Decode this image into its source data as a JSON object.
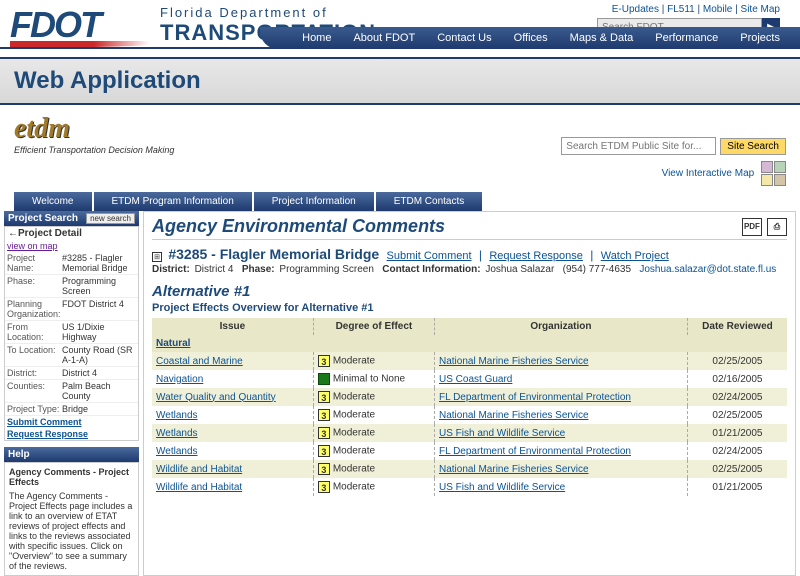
{
  "fdot": {
    "logo_text": "FDOT",
    "dept1": "Florida Department of",
    "dept2": "TRANSPORTATION",
    "util_links": [
      "E-Updates",
      "FL511",
      "Mobile",
      "Site Map"
    ],
    "search_placeholder": "Search FDOT...",
    "nav": [
      "Home",
      "About FDOT",
      "Contact Us",
      "Offices",
      "Maps & Data",
      "Performance",
      "Projects"
    ]
  },
  "app": {
    "banner_title": "Web Application",
    "etdm_logo": "etdm",
    "etdm_sub": "Efficient Transportation Decision Making",
    "etdm_search_placeholder": "Search ETDM Public Site for...",
    "site_search_btn": "Site Search",
    "view_map": "View Interactive Map"
  },
  "tabs": [
    "Welcome",
    "ETDM Program Information",
    "Project Information",
    "ETDM Contacts"
  ],
  "sidebar": {
    "search_head": "Project Search",
    "new_search": "new search",
    "detail_head": "←Project Detail",
    "view_on_map": "view on map",
    "rows": [
      {
        "label": "Project Name:",
        "val": "#3285 - Flagler Memorial Bridge"
      },
      {
        "label": "Phase:",
        "val": "Programming Screen"
      },
      {
        "label": "Planning Organization:",
        "val": "FDOT District 4"
      },
      {
        "label": "From Location:",
        "val": "US 1/Dixie Highway"
      },
      {
        "label": "To Location:",
        "val": "County Road (SR A-1-A)"
      },
      {
        "label": "District:",
        "val": "District 4"
      },
      {
        "label": "Counties:",
        "val": "Palm Beach County"
      },
      {
        "label": "Project Type:",
        "val": "Bridge"
      }
    ],
    "submit_comment": "Submit Comment",
    "request_response": "Request Response",
    "help_head": "Help",
    "help_title": "Agency Comments - Project Effects",
    "help_text": "The Agency Comments - Project Effects page includes a link to an overview of ETAT reviews of project effects and links to the reviews associated with specific issues.   Click on \"Overview\" to see a summary of the reviews."
  },
  "main": {
    "page_title": "Agency Environmental Comments",
    "pdf_icon": "PDF",
    "print_icon": "⎙",
    "box_icon": "⊞",
    "proj_id": "#3285 - Flagler Memorial Bridge",
    "submit_comment": "Submit Comment",
    "request_response": "Request Response",
    "watch_project": "Watch Project",
    "district_label": "District:",
    "district_val": "District 4",
    "phase_label": "Phase:",
    "phase_val": "Programming Screen",
    "contact_label": "Contact Information:",
    "contact_name": "Joshua Salazar",
    "contact_phone": "(954) 777-4635",
    "contact_email": "Joshua.salazar@dot.state.fl.us",
    "alt_title": "Alternative #1",
    "alt_sub": "Project Effects Overview for Alternative #1",
    "columns": [
      "Issue",
      "Degree of Effect",
      "Organization",
      "Date Reviewed"
    ],
    "section": "Natural",
    "rows": [
      {
        "issue": "Coastal and Marine",
        "badge": "3",
        "cls": "y",
        "deg": "Moderate",
        "org": "National Marine Fisheries Service",
        "date": "02/25/2005"
      },
      {
        "issue": "Navigation",
        "badge": "",
        "cls": "g",
        "deg": "Minimal to None",
        "org": "US Coast Guard",
        "date": "02/16/2005"
      },
      {
        "issue": "Water Quality and Quantity",
        "badge": "3",
        "cls": "y",
        "deg": "Moderate",
        "org": "FL Department of Environmental Protection",
        "date": "02/24/2005"
      },
      {
        "issue": "Wetlands",
        "badge": "3",
        "cls": "y",
        "deg": "Moderate",
        "org": "National Marine Fisheries Service",
        "date": "02/25/2005"
      },
      {
        "issue": "Wetlands",
        "badge": "3",
        "cls": "y",
        "deg": "Moderate",
        "org": "US Fish and Wildlife Service",
        "date": "01/21/2005"
      },
      {
        "issue": "Wetlands",
        "badge": "3",
        "cls": "y",
        "deg": "Moderate",
        "org": "FL Department of Environmental Protection",
        "date": "02/24/2005"
      },
      {
        "issue": "Wildlife and Habitat",
        "badge": "3",
        "cls": "y",
        "deg": "Moderate",
        "org": "National Marine Fisheries Service",
        "date": "02/25/2005"
      },
      {
        "issue": "Wildlife and Habitat",
        "badge": "3",
        "cls": "y",
        "deg": "Moderate",
        "org": "US Fish and Wildlife Service",
        "date": "01/21/2005"
      }
    ]
  }
}
